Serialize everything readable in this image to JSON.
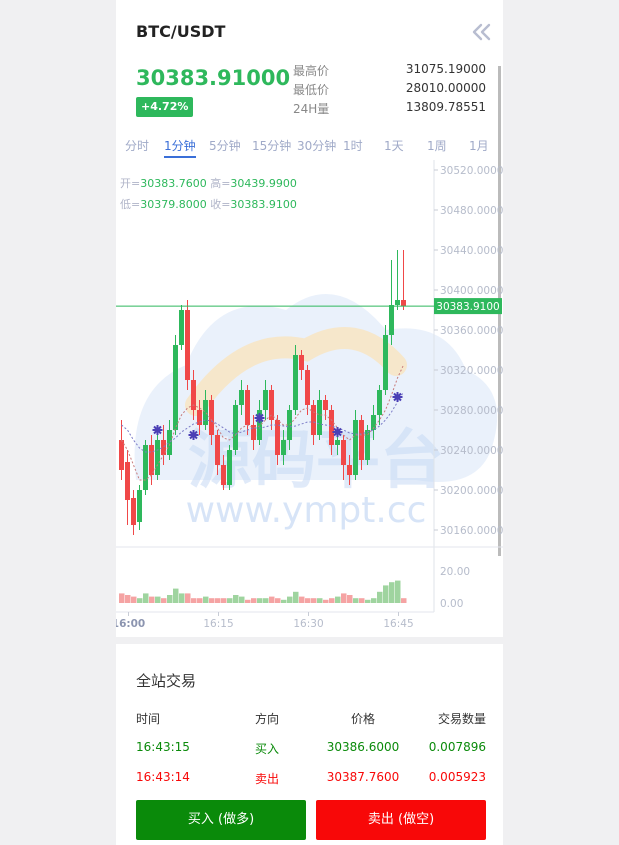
{
  "header": {
    "pair": "BTC/USDT",
    "back_icon": "double-chevron-left-icon"
  },
  "ticker": {
    "price": "30383.91000",
    "change": "+4.72%",
    "stats": [
      {
        "label": "最高价",
        "value": "31075.19000"
      },
      {
        "label": "最低价",
        "value": "28010.00000"
      },
      {
        "label": "24H量",
        "value": "13809.78551"
      }
    ]
  },
  "tabs": [
    "分时",
    "1分钟",
    "5分钟",
    "15分钟",
    "30分钟",
    "1时",
    "1天",
    "1周",
    "1月"
  ],
  "active_tab": "1分钟",
  "ohlc": {
    "open_label": "开=",
    "open": "30383.7600",
    "high_label": "高=",
    "high": "30439.9900",
    "low_label": "低=",
    "low": "30379.8000",
    "close_label": "收=",
    "close": "30383.9100"
  },
  "watermark": {
    "logo_text": "源码平台",
    "url": "www.ympt.cc"
  },
  "chart_data": {
    "type": "candlestick",
    "price_axis": [
      "30520.0000",
      "30480.0000",
      "30440.0000",
      "30400.0000",
      "30360.0000",
      "30320.0000",
      "30280.0000",
      "30240.0000",
      "30200.0000",
      "30160.0000"
    ],
    "ylim": [
      30145,
      30525
    ],
    "last_price_label": "30383.9100",
    "last_price": 30383.91,
    "volume_axis": [
      "20.00",
      "0.00"
    ],
    "volume_max": 30,
    "time_axis": [
      "16:00",
      "16:15",
      "16:30",
      "16:45"
    ],
    "time_axis_index": [
      0,
      15,
      30,
      45
    ],
    "candles": [
      [
        30250,
        30220,
        30270,
        30210
      ],
      [
        30228,
        30190,
        30240,
        30165
      ],
      [
        30192,
        30165,
        30200,
        30155
      ],
      [
        30168,
        30200,
        30205,
        30160
      ],
      [
        30200,
        30245,
        30250,
        30195
      ],
      [
        30245,
        30215,
        30255,
        30205
      ],
      [
        30215,
        30250,
        30255,
        30210
      ],
      [
        30250,
        30235,
        30265,
        30225
      ],
      [
        30235,
        30260,
        30270,
        30230
      ],
      [
        30260,
        30345,
        30355,
        30255
      ],
      [
        30345,
        30380,
        30385,
        30340
      ],
      [
        30380,
        30310,
        30390,
        30300
      ],
      [
        30310,
        30280,
        30320,
        30270
      ],
      [
        30280,
        30265,
        30290,
        30255
      ],
      [
        30265,
        30290,
        30300,
        30260
      ],
      [
        30290,
        30255,
        30295,
        30245
      ],
      [
        30255,
        30225,
        30260,
        30215
      ],
      [
        30225,
        30205,
        30235,
        30200
      ],
      [
        30205,
        30240,
        30245,
        30200
      ],
      [
        30240,
        30285,
        30290,
        30235
      ],
      [
        30285,
        30300,
        30310,
        30275
      ],
      [
        30300,
        30265,
        30305,
        30255
      ],
      [
        30265,
        30250,
        30275,
        30240
      ],
      [
        30250,
        30280,
        30290,
        30245
      ],
      [
        30280,
        30300,
        30310,
        30270
      ],
      [
        30300,
        30270,
        30305,
        30260
      ],
      [
        30270,
        30235,
        30275,
        30225
      ],
      [
        30235,
        30250,
        30260,
        30225
      ],
      [
        30250,
        30280,
        30285,
        30240
      ],
      [
        30280,
        30335,
        30345,
        30275
      ],
      [
        30335,
        30320,
        30340,
        30310
      ],
      [
        30320,
        30285,
        30325,
        30275
      ],
      [
        30285,
        30255,
        30290,
        30245
      ],
      [
        30255,
        30290,
        30300,
        30250
      ],
      [
        30290,
        30280,
        30295,
        30270
      ],
      [
        30280,
        30245,
        30285,
        30235
      ],
      [
        30245,
        30250,
        30260,
        30235
      ],
      [
        30250,
        30225,
        30255,
        30210
      ],
      [
        30225,
        30215,
        30235,
        30205
      ],
      [
        30215,
        30270,
        30280,
        30210
      ],
      [
        30270,
        30230,
        30275,
        30220
      ],
      [
        30230,
        30260,
        30265,
        30225
      ],
      [
        30260,
        30275,
        30285,
        30250
      ],
      [
        30275,
        30300,
        30305,
        30265
      ],
      [
        30300,
        30355,
        30365,
        30295
      ],
      [
        30355,
        30385,
        30430,
        30345
      ],
      [
        30385,
        30390,
        30440,
        30380
      ],
      [
        30390,
        30384,
        30440,
        30380
      ]
    ],
    "volume": [
      6,
      5,
      4,
      3,
      6,
      4,
      4,
      3,
      5,
      9,
      6,
      6,
      3,
      3,
      4,
      3,
      3,
      3,
      3,
      5,
      4,
      2,
      3,
      3,
      3,
      4,
      3,
      2,
      4,
      7,
      4,
      3,
      3,
      3,
      2,
      3,
      4,
      6,
      5,
      3,
      3,
      2,
      3,
      7,
      11,
      13,
      14,
      3
    ],
    "ma": [
      30250,
      30240,
      30225,
      30210,
      30210,
      30215,
      30225,
      30235,
      30245,
      30262,
      30275,
      30282,
      30285,
      30282,
      30278,
      30270,
      30262,
      30252,
      30250,
      30255,
      30262,
      30265,
      30262,
      30264,
      30270,
      30275,
      30270,
      30265,
      30265,
      30272,
      30280,
      30282,
      30278,
      30275,
      30275,
      30270,
      30262,
      30255,
      30250,
      30255,
      30255,
      30255,
      30262,
      30270,
      30280,
      30295,
      30312,
      30325
    ],
    "ma2": [
      30265,
      30260,
      30250,
      30242,
      30238,
      30238,
      30240,
      30243,
      30248,
      30252,
      30258,
      30262,
      30266,
      30268,
      30270,
      30269,
      30266,
      30262,
      30258,
      30256,
      30258,
      30260,
      30262,
      30262,
      30263,
      30265,
      30265,
      30264,
      30263,
      30264,
      30266,
      30268,
      30268,
      30266,
      30265,
      30264,
      30262,
      30260,
      30257,
      30256,
      30256,
      30258,
      30260,
      30264,
      30270,
      30278,
      30288,
      30298
    ],
    "markers": [
      {
        "index": 6,
        "price": 30260
      },
      {
        "index": 12,
        "price": 30255
      },
      {
        "index": 23,
        "price": 30272
      },
      {
        "index": 36,
        "price": 30258
      },
      {
        "index": 46,
        "price": 30293
      }
    ],
    "colors": {
      "up": "#2eb85c",
      "down": "#f04848",
      "vol_up": "#9fd49f",
      "vol_down": "#f5a3a3"
    }
  },
  "trades": {
    "title": "全站交易",
    "headers": [
      "时间",
      "方向",
      "价格",
      "交易数量"
    ],
    "rows": [
      {
        "time": "16:43:15",
        "side": "买入",
        "price": "30386.6000",
        "qty": "0.007896",
        "color": "#0a8a0a"
      },
      {
        "time": "16:43:14",
        "side": "卖出",
        "price": "30387.7600",
        "qty": "0.005923",
        "color": "#f80808"
      }
    ]
  },
  "actions": {
    "buy_label": "买入 (做多)",
    "sell_label": "卖出 (做空)"
  }
}
